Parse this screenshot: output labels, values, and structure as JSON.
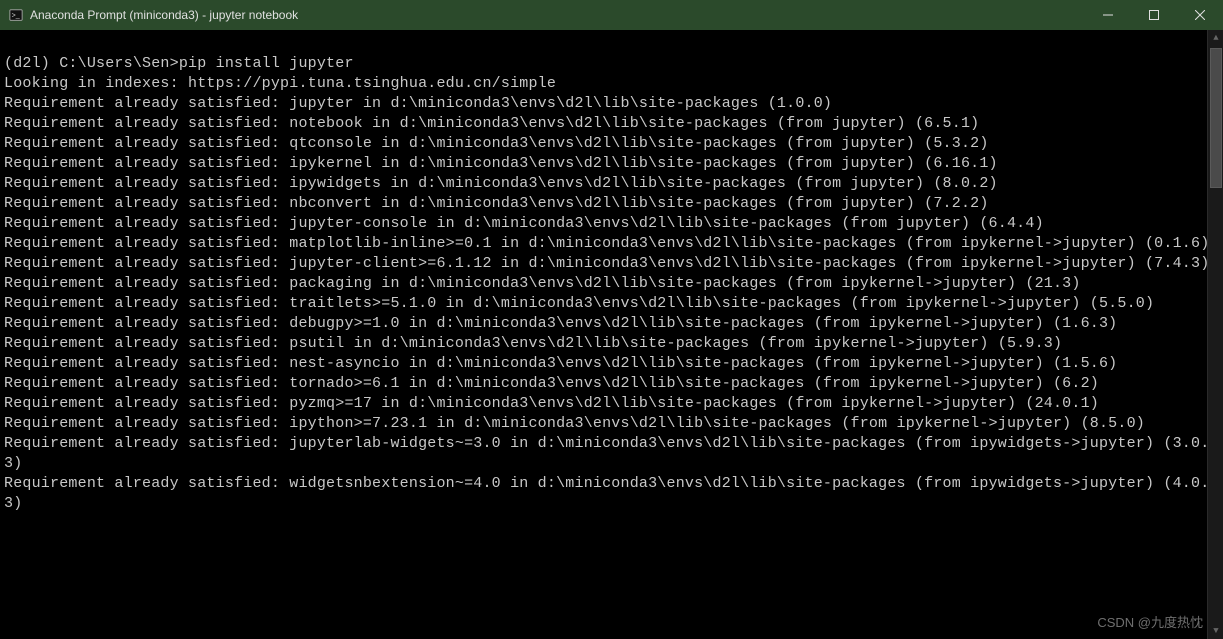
{
  "window": {
    "title": "Anaconda Prompt (miniconda3) - jupyter  notebook"
  },
  "terminal": {
    "prompt": "(d2l) C:\\Users\\Sen>",
    "command": "pip install jupyter",
    "lookup_line": "Looking in indexes: https://pypi.tuna.tsinghua.edu.cn/simple",
    "lines": [
      "Requirement already satisfied: jupyter in d:\\miniconda3\\envs\\d2l\\lib\\site-packages (1.0.0)",
      "Requirement already satisfied: notebook in d:\\miniconda3\\envs\\d2l\\lib\\site-packages (from jupyter) (6.5.1)",
      "Requirement already satisfied: qtconsole in d:\\miniconda3\\envs\\d2l\\lib\\site-packages (from jupyter) (5.3.2)",
      "Requirement already satisfied: ipykernel in d:\\miniconda3\\envs\\d2l\\lib\\site-packages (from jupyter) (6.16.1)",
      "Requirement already satisfied: ipywidgets in d:\\miniconda3\\envs\\d2l\\lib\\site-packages (from jupyter) (8.0.2)",
      "Requirement already satisfied: nbconvert in d:\\miniconda3\\envs\\d2l\\lib\\site-packages (from jupyter) (7.2.2)",
      "Requirement already satisfied: jupyter-console in d:\\miniconda3\\envs\\d2l\\lib\\site-packages (from jupyter) (6.4.4)",
      "Requirement already satisfied: matplotlib-inline>=0.1 in d:\\miniconda3\\envs\\d2l\\lib\\site-packages (from ipykernel->jupyter) (0.1.6)",
      "Requirement already satisfied: jupyter-client>=6.1.12 in d:\\miniconda3\\envs\\d2l\\lib\\site-packages (from ipykernel->jupyter) (7.4.3)",
      "Requirement already satisfied: packaging in d:\\miniconda3\\envs\\d2l\\lib\\site-packages (from ipykernel->jupyter) (21.3)",
      "Requirement already satisfied: traitlets>=5.1.0 in d:\\miniconda3\\envs\\d2l\\lib\\site-packages (from ipykernel->jupyter) (5.5.0)",
      "Requirement already satisfied: debugpy>=1.0 in d:\\miniconda3\\envs\\d2l\\lib\\site-packages (from ipykernel->jupyter) (1.6.3)",
      "Requirement already satisfied: psutil in d:\\miniconda3\\envs\\d2l\\lib\\site-packages (from ipykernel->jupyter) (5.9.3)",
      "Requirement already satisfied: nest-asyncio in d:\\miniconda3\\envs\\d2l\\lib\\site-packages (from ipykernel->jupyter) (1.5.6)",
      "Requirement already satisfied: tornado>=6.1 in d:\\miniconda3\\envs\\d2l\\lib\\site-packages (from ipykernel->jupyter) (6.2)",
      "Requirement already satisfied: pyzmq>=17 in d:\\miniconda3\\envs\\d2l\\lib\\site-packages (from ipykernel->jupyter) (24.0.1)",
      "Requirement already satisfied: ipython>=7.23.1 in d:\\miniconda3\\envs\\d2l\\lib\\site-packages (from ipykernel->jupyter) (8.5.0)",
      "Requirement already satisfied: jupyterlab-widgets~=3.0 in d:\\miniconda3\\envs\\d2l\\lib\\site-packages (from ipywidgets->jupyter) (3.0.3)",
      "Requirement already satisfied: widgetsnbextension~=4.0 in d:\\miniconda3\\envs\\d2l\\lib\\site-packages (from ipywidgets->jupyter) (4.0.3)"
    ]
  },
  "watermark": "CSDN @九度热忱"
}
